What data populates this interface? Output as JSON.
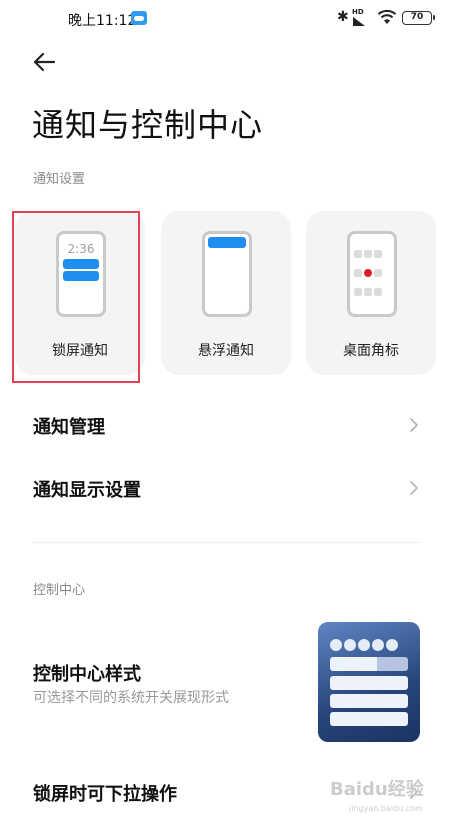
{
  "status_bar": {
    "time": "晚上11:12",
    "battery": "70",
    "signal_label": "HD",
    "bluetooth_icon": "bluetooth-icon",
    "wifi_icon": "wifi-icon",
    "cloud_icon": "cloud-icon"
  },
  "header": {
    "back_icon": "arrow-left-icon",
    "title": "通知与控制中心"
  },
  "notification_section": {
    "label": "通知设置",
    "cards": [
      {
        "label": "锁屏通知",
        "preview_time": "2:36",
        "selected": true
      },
      {
        "label": "悬浮通知",
        "selected": false
      },
      {
        "label": "桌面角标",
        "selected": false
      }
    ],
    "rows": [
      {
        "title": "通知管理"
      },
      {
        "title": "通知显示设置"
      }
    ]
  },
  "control_center_section": {
    "label": "控制中心",
    "style_title": "控制中心样式",
    "style_description": "可选择不同的系统开关展现形式",
    "lock_pulldown_title": "锁屏时可下拉操作"
  },
  "watermark": {
    "text": "Baidu经验",
    "sub": "jingyan.baidu.com"
  },
  "colors": {
    "accent_blue": "#1f8ef0",
    "highlight_red": "#e0454f",
    "badge_red": "#e21d1d"
  }
}
